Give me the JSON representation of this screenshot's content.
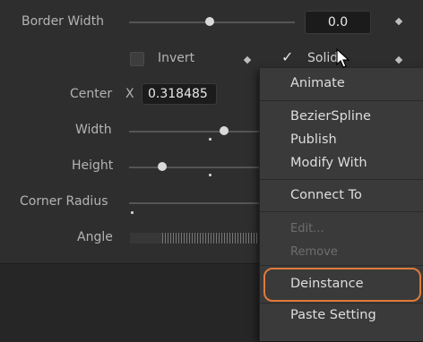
{
  "inspector": {
    "border_width": {
      "label": "Border Width",
      "value": "0.0"
    },
    "invert": {
      "label": "Invert",
      "checked": false
    },
    "solid": {
      "label": "Solid",
      "checked": true
    },
    "center": {
      "label": "Center",
      "axis": "X",
      "value": "0.318485"
    },
    "width": {
      "label": "Width"
    },
    "height": {
      "label": "Height"
    },
    "corner_radius": {
      "label": "Corner Radius"
    },
    "angle": {
      "label": "Angle"
    }
  },
  "context_menu": {
    "items": [
      {
        "label": "Animate",
        "enabled": true
      },
      {
        "label": "BezierSpline",
        "enabled": true
      },
      {
        "label": "Publish",
        "enabled": true
      },
      {
        "label": "Modify With",
        "enabled": true
      },
      {
        "label": "Connect To",
        "enabled": true
      },
      {
        "label": "Edit...",
        "enabled": false
      },
      {
        "label": "Remove",
        "enabled": false
      },
      {
        "label": "Deinstance",
        "enabled": true,
        "highlighted": true
      },
      {
        "label": "Paste Setting",
        "enabled": true
      }
    ]
  },
  "colors": {
    "highlight": "#e07a3a",
    "panel_bg": "#2e2e2e",
    "menu_bg": "#3a3a3a"
  },
  "icons": [
    "keyframe-diamond-icon",
    "checkmark-icon",
    "mouse-pointer-icon"
  ]
}
